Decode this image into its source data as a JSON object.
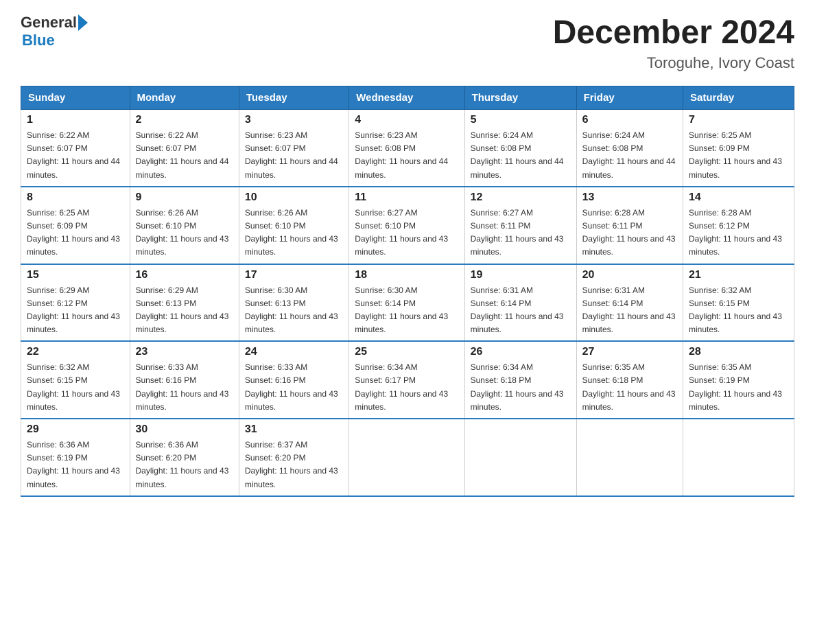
{
  "header": {
    "logo_general": "General",
    "logo_blue": "Blue",
    "title": "December 2024",
    "subtitle": "Toroguhe, Ivory Coast"
  },
  "days_of_week": [
    "Sunday",
    "Monday",
    "Tuesday",
    "Wednesday",
    "Thursday",
    "Friday",
    "Saturday"
  ],
  "weeks": [
    [
      {
        "day": "1",
        "sunrise": "6:22 AM",
        "sunset": "6:07 PM",
        "daylight": "11 hours and 44 minutes."
      },
      {
        "day": "2",
        "sunrise": "6:22 AM",
        "sunset": "6:07 PM",
        "daylight": "11 hours and 44 minutes."
      },
      {
        "day": "3",
        "sunrise": "6:23 AM",
        "sunset": "6:07 PM",
        "daylight": "11 hours and 44 minutes."
      },
      {
        "day": "4",
        "sunrise": "6:23 AM",
        "sunset": "6:08 PM",
        "daylight": "11 hours and 44 minutes."
      },
      {
        "day": "5",
        "sunrise": "6:24 AM",
        "sunset": "6:08 PM",
        "daylight": "11 hours and 44 minutes."
      },
      {
        "day": "6",
        "sunrise": "6:24 AM",
        "sunset": "6:08 PM",
        "daylight": "11 hours and 44 minutes."
      },
      {
        "day": "7",
        "sunrise": "6:25 AM",
        "sunset": "6:09 PM",
        "daylight": "11 hours and 43 minutes."
      }
    ],
    [
      {
        "day": "8",
        "sunrise": "6:25 AM",
        "sunset": "6:09 PM",
        "daylight": "11 hours and 43 minutes."
      },
      {
        "day": "9",
        "sunrise": "6:26 AM",
        "sunset": "6:10 PM",
        "daylight": "11 hours and 43 minutes."
      },
      {
        "day": "10",
        "sunrise": "6:26 AM",
        "sunset": "6:10 PM",
        "daylight": "11 hours and 43 minutes."
      },
      {
        "day": "11",
        "sunrise": "6:27 AM",
        "sunset": "6:10 PM",
        "daylight": "11 hours and 43 minutes."
      },
      {
        "day": "12",
        "sunrise": "6:27 AM",
        "sunset": "6:11 PM",
        "daylight": "11 hours and 43 minutes."
      },
      {
        "day": "13",
        "sunrise": "6:28 AM",
        "sunset": "6:11 PM",
        "daylight": "11 hours and 43 minutes."
      },
      {
        "day": "14",
        "sunrise": "6:28 AM",
        "sunset": "6:12 PM",
        "daylight": "11 hours and 43 minutes."
      }
    ],
    [
      {
        "day": "15",
        "sunrise": "6:29 AM",
        "sunset": "6:12 PM",
        "daylight": "11 hours and 43 minutes."
      },
      {
        "day": "16",
        "sunrise": "6:29 AM",
        "sunset": "6:13 PM",
        "daylight": "11 hours and 43 minutes."
      },
      {
        "day": "17",
        "sunrise": "6:30 AM",
        "sunset": "6:13 PM",
        "daylight": "11 hours and 43 minutes."
      },
      {
        "day": "18",
        "sunrise": "6:30 AM",
        "sunset": "6:14 PM",
        "daylight": "11 hours and 43 minutes."
      },
      {
        "day": "19",
        "sunrise": "6:31 AM",
        "sunset": "6:14 PM",
        "daylight": "11 hours and 43 minutes."
      },
      {
        "day": "20",
        "sunrise": "6:31 AM",
        "sunset": "6:14 PM",
        "daylight": "11 hours and 43 minutes."
      },
      {
        "day": "21",
        "sunrise": "6:32 AM",
        "sunset": "6:15 PM",
        "daylight": "11 hours and 43 minutes."
      }
    ],
    [
      {
        "day": "22",
        "sunrise": "6:32 AM",
        "sunset": "6:15 PM",
        "daylight": "11 hours and 43 minutes."
      },
      {
        "day": "23",
        "sunrise": "6:33 AM",
        "sunset": "6:16 PM",
        "daylight": "11 hours and 43 minutes."
      },
      {
        "day": "24",
        "sunrise": "6:33 AM",
        "sunset": "6:16 PM",
        "daylight": "11 hours and 43 minutes."
      },
      {
        "day": "25",
        "sunrise": "6:34 AM",
        "sunset": "6:17 PM",
        "daylight": "11 hours and 43 minutes."
      },
      {
        "day": "26",
        "sunrise": "6:34 AM",
        "sunset": "6:18 PM",
        "daylight": "11 hours and 43 minutes."
      },
      {
        "day": "27",
        "sunrise": "6:35 AM",
        "sunset": "6:18 PM",
        "daylight": "11 hours and 43 minutes."
      },
      {
        "day": "28",
        "sunrise": "6:35 AM",
        "sunset": "6:19 PM",
        "daylight": "11 hours and 43 minutes."
      }
    ],
    [
      {
        "day": "29",
        "sunrise": "6:36 AM",
        "sunset": "6:19 PM",
        "daylight": "11 hours and 43 minutes."
      },
      {
        "day": "30",
        "sunrise": "6:36 AM",
        "sunset": "6:20 PM",
        "daylight": "11 hours and 43 minutes."
      },
      {
        "day": "31",
        "sunrise": "6:37 AM",
        "sunset": "6:20 PM",
        "daylight": "11 hours and 43 minutes."
      },
      null,
      null,
      null,
      null
    ]
  ]
}
